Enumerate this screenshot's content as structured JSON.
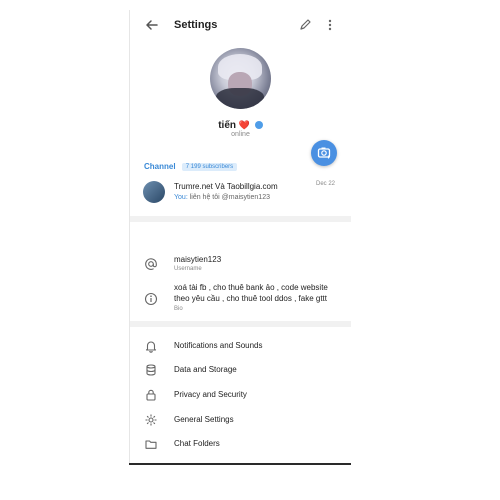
{
  "header": {
    "title": "Settings",
    "back_icon": "back-arrow-icon",
    "edit_icon": "pencil-icon",
    "more_icon": "more-vertical-icon"
  },
  "profile": {
    "name": "tiến",
    "status": "online",
    "heart": "❤️",
    "verified_color": "#4f9de8"
  },
  "channel": {
    "label": "Channel",
    "subscribers": "7 199 subscribers"
  },
  "channel_post": {
    "title": "Trumre.net Và Taobillgia.com",
    "you_prefix": "You:",
    "message": "liên hệ tôi @maisytien123",
    "date": "Dec 22"
  },
  "account": {
    "username_value": "maisytien123",
    "username_label": "Username",
    "bio_value": "xoá tài fb , cho thuê bank ảo , code website theo yêu cầu , cho thuê tool ddos , fake gttt",
    "bio_label": "Bio"
  },
  "menu": [
    {
      "label": "Notifications and Sounds",
      "icon": "bell-icon"
    },
    {
      "label": "Data and Storage",
      "icon": "database-icon"
    },
    {
      "label": "Privacy and Security",
      "icon": "lock-icon"
    },
    {
      "label": "General Settings",
      "icon": "gear-icon"
    },
    {
      "label": "Chat Folders",
      "icon": "folder-icon"
    }
  ],
  "colors": {
    "accent": "#4a90e2",
    "link": "#3a89d6"
  }
}
